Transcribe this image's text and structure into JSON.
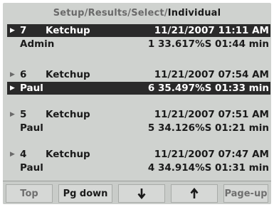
{
  "breadcrumb": {
    "items": [
      "Setup",
      "Results",
      "Select",
      "Individual"
    ]
  },
  "records": [
    {
      "number": "7",
      "name": "Ketchup",
      "datetime": "11/21/2007 11:11 AM",
      "user": "Admin",
      "result": "1 33.617%S 01:44 min",
      "selected_line": "header"
    },
    {
      "number": "6",
      "name": "Ketchup",
      "datetime": "11/21/2007 07:54 AM",
      "user": "Paul",
      "result": "6 35.497%S 01:33 min",
      "selected_line": "detail"
    },
    {
      "number": "5",
      "name": "Ketchup",
      "datetime": "11/21/2007 07:51 AM",
      "user": "Paul",
      "result": "5 34.126%S 01:21 min",
      "selected_line": "none"
    },
    {
      "number": "4",
      "name": "Ketchup",
      "datetime": "11/21/2007 07:47 AM",
      "user": "Paul",
      "result": "4 34.914%S 01:31 min",
      "selected_line": "none"
    }
  ],
  "buttons": {
    "top": "Top",
    "pg_down": "Pg down",
    "down_icon": "arrow-down-icon",
    "up_icon": "arrow-up-icon",
    "page_up": "Page-up"
  },
  "colors": {
    "screen_bg": "#cfd2cf",
    "highlight_bg": "#2a2a2a",
    "text": "#1a1a1a",
    "dim_text": "#6a6a6a"
  }
}
